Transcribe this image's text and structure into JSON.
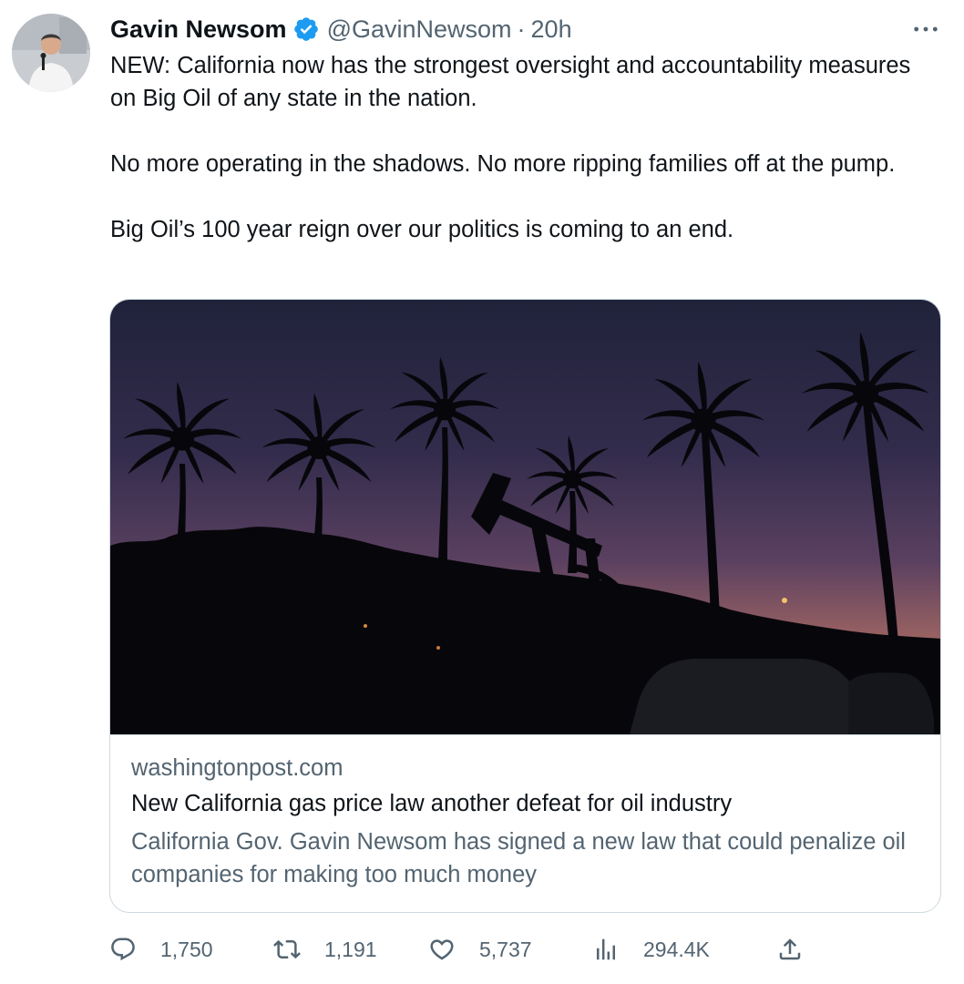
{
  "tweet": {
    "author_name": "Gavin Newsom",
    "handle": "@GavinNewsom",
    "separator": "·",
    "time": "20h",
    "paragraphs": [
      "NEW: California now has the strongest oversight and accountability measures on Big Oil of any state in the nation.",
      "No more operating in the shadows. No more ripping families off at the pump.",
      "Big Oil’s 100 year reign over our politics is coming to an end."
    ]
  },
  "card": {
    "domain": "washingtonpost.com",
    "title": "New California gas price law another defeat for oil industry",
    "description": "California Gov. Gavin Newsom has signed a new law that could penalize oil companies for making too much money"
  },
  "stats": {
    "replies": "1,750",
    "retweets": "1,191",
    "likes": "5,737",
    "views": "294.4K"
  },
  "icons": {
    "verified": "verified-badge-icon",
    "more": "more-icon",
    "reply": "reply-icon",
    "retweet": "retweet-icon",
    "like": "heart-icon",
    "views": "views-icon",
    "share": "share-icon"
  },
  "colors": {
    "text_primary": "#0f1419",
    "text_secondary": "#536471",
    "verified_blue": "#1d9bf0",
    "border": "#cfd9de"
  }
}
